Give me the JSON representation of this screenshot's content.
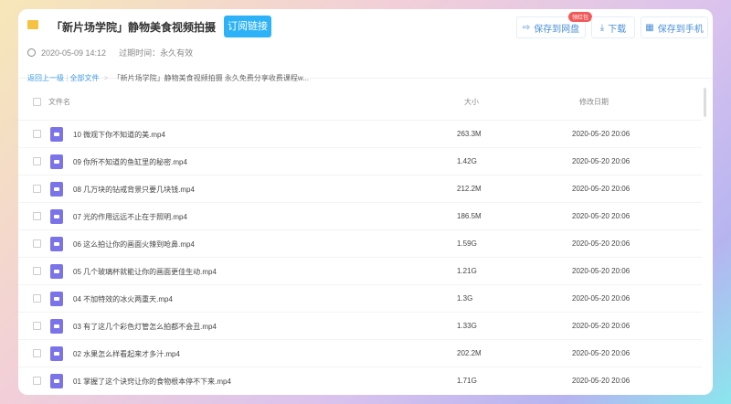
{
  "header": {
    "title": "「新片场学院」静物美食视频拍摄",
    "ellipsis": "...",
    "subscribe": "订阅链接",
    "date": "2020-05-09 14:12",
    "expire": "过期时间：永久有效"
  },
  "actions": {
    "save_disk": "保存到网盘",
    "badge": "领红包",
    "download": "下载",
    "save_phone": "保存到手机"
  },
  "breadcrumb": {
    "back": "返回上一级",
    "sep": "|",
    "all": "全部文件",
    "arrow": ">",
    "current": "「新片场学院」静物美食视频拍摄 永久免费分享收费课程w..."
  },
  "columns": {
    "name": "文件名",
    "size": "大小",
    "date": "修改日期"
  },
  "files": [
    {
      "name": "10 微观下你不知道的美.mp4",
      "size": "263.3M",
      "date": "2020-05-20 20:06"
    },
    {
      "name": "09 你所不知道的鱼缸里的秘密.mp4",
      "size": "1.42G",
      "date": "2020-05-20 20:06"
    },
    {
      "name": "08 几万块的钻戒背景只要几块钱.mp4",
      "size": "212.2M",
      "date": "2020-05-20 20:06"
    },
    {
      "name": "07 光的作用远远不止在于照明.mp4",
      "size": "186.5M",
      "date": "2020-05-20 20:06"
    },
    {
      "name": "06 这么拍让你的画面火辣到呛鼻.mp4",
      "size": "1.59G",
      "date": "2020-05-20 20:06"
    },
    {
      "name": "05 几个玻璃杯就能让你的画面更佳生动.mp4",
      "size": "1.21G",
      "date": "2020-05-20 20:06"
    },
    {
      "name": "04 不加特效的冰火两重天.mp4",
      "size": "1.3G",
      "date": "2020-05-20 20:06"
    },
    {
      "name": "03 有了这几个彩色灯管怎么拍都不会丑.mp4",
      "size": "1.33G",
      "date": "2020-05-20 20:06"
    },
    {
      "name": "02 水果怎么样看起来才多汁.mp4",
      "size": "202.2M",
      "date": "2020-05-20 20:06"
    },
    {
      "name": "01 掌握了这个诀窍让你的食物根本停不下来.mp4",
      "size": "1.71G",
      "date": "2020-05-20 20:06"
    }
  ]
}
